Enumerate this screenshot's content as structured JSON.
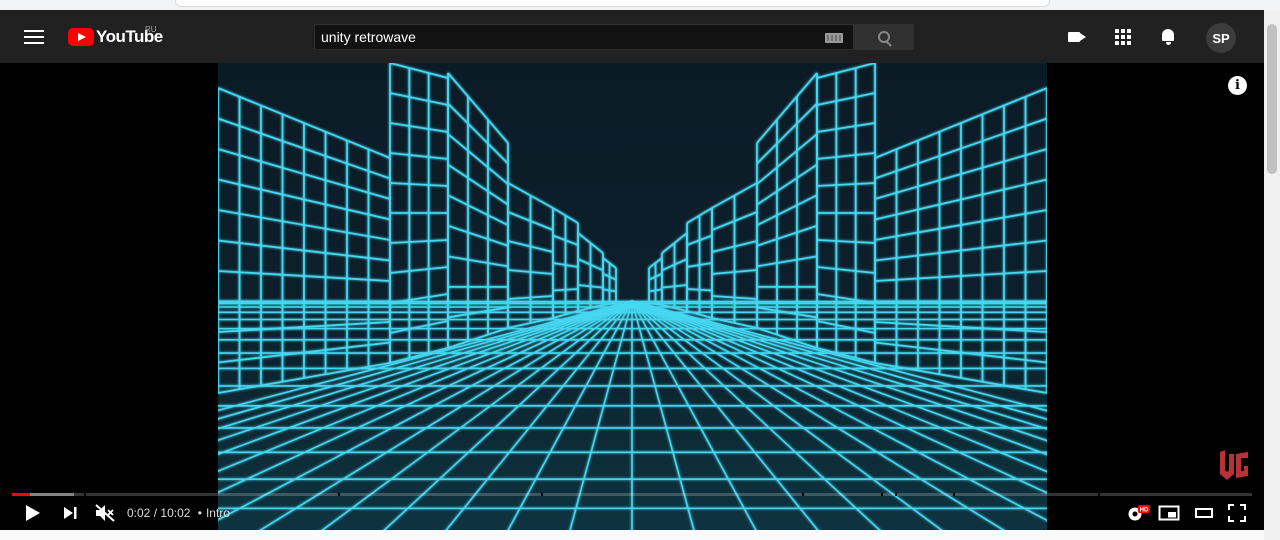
{
  "header": {
    "logo_text": "YouTube",
    "region": "RU",
    "search_value": "unity retrowave",
    "avatar_initials": "SP"
  },
  "player": {
    "current_time": "0:02",
    "separator": "/",
    "duration": "10:02",
    "chapter_dot": "•",
    "chapter": "Intro",
    "played_fraction": 0.0016,
    "loaded_fraction": 0.05,
    "chapter_marks_fraction": [
      0.058,
      0.263,
      0.427,
      0.637,
      0.701,
      0.712,
      0.759,
      0.876
    ],
    "info_glyph": "i",
    "hd_badge": "HD",
    "accent_color": "#ff0000",
    "grid_color": "#45d6f0"
  },
  "icons": [
    "menu-icon",
    "youtube-logo-icon",
    "keyboard-icon",
    "search-icon",
    "create-video-icon",
    "apps-icon",
    "notifications-icon",
    "info-icon",
    "channel-watermark-icon",
    "play-icon",
    "next-icon",
    "mute-icon",
    "settings-icon",
    "miniplayer-icon",
    "theater-mode-icon",
    "fullscreen-icon"
  ]
}
